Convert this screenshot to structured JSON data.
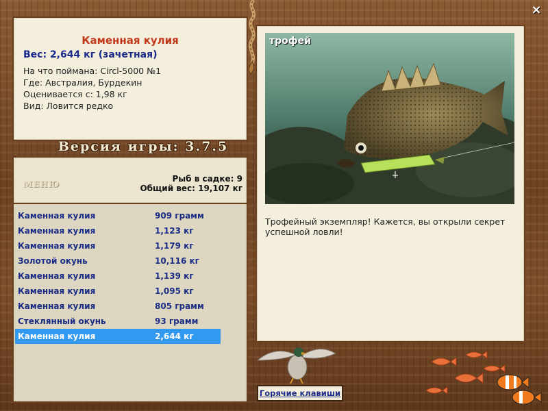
{
  "info": {
    "fish_name": "Каменная кулия",
    "weight": "Вес: 2,644 кг (зачетная)",
    "caught_on": "На что поймана: Circl-5000 №1",
    "location": "Где: Австралия, Бурдекин",
    "valued_from": "Оценивается с: 1,98 кг",
    "species_note": "Вид: Ловится редко"
  },
  "version_label": "Версия игры: 3.7.5",
  "catch_header": {
    "menu_label": "МЕНЮ",
    "fish_count": "Рыб в садке: 9",
    "total_weight": "Общий вес: 19,107 кг"
  },
  "catch_list": [
    {
      "name": "Каменная кулия",
      "weight": "909 грамм"
    },
    {
      "name": "Каменная кулия",
      "weight": "1,123 кг"
    },
    {
      "name": "Каменная кулия",
      "weight": "1,179 кг"
    },
    {
      "name": "Золотой окунь",
      "weight": "10,116 кг"
    },
    {
      "name": "Каменная кулия",
      "weight": "1,139 кг"
    },
    {
      "name": "Каменная кулия",
      "weight": "1,095 кг"
    },
    {
      "name": "Каменная кулия",
      "weight": "805 грамм"
    },
    {
      "name": "Стеклянный окунь",
      "weight": "93 грамм"
    },
    {
      "name": "Каменная кулия",
      "weight": "2,644 кг",
      "selected": true
    }
  ],
  "trophy": {
    "label": "трофей",
    "text": "Трофейный экземпляр! Кажется, вы открыли секрет успешной ловли!"
  },
  "hotkeys_label": "Горячие клавиши",
  "close_label": "×",
  "colors": {
    "fish_name": "#c0391b",
    "weight": "#1a2a8a",
    "list_text": "#1b2d86",
    "selection": "#3299f0",
    "panel_bg": "#f4eedc"
  },
  "icons": [
    "close-icon",
    "fishing-lure-icon",
    "duck-icon",
    "goldfish-icon",
    "clownfish-icon"
  ]
}
